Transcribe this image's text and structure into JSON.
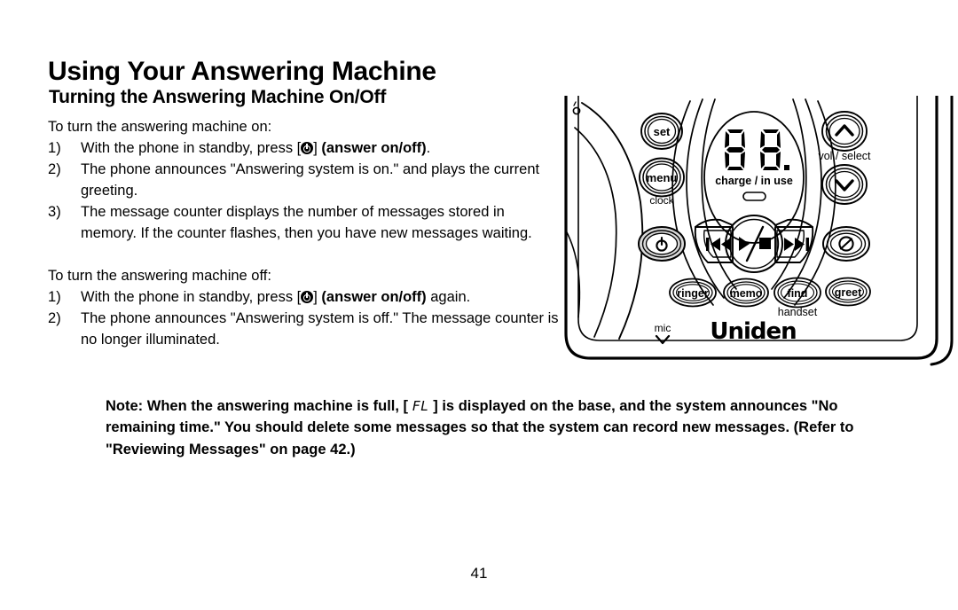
{
  "page": {
    "title": "Using Your Answering Machine",
    "subtitle": "Turning the Answering Machine On/Off",
    "number": "41"
  },
  "section_on": {
    "lead": "To turn the answering machine on:",
    "steps": [
      {
        "pre": "With the phone in standby, press [",
        "icon": "power-icon",
        "mid": "] ",
        "bold": "(answer on/off)",
        "post": "."
      },
      {
        "text": "The phone announces \"Answering system is on.\" and plays the current greeting."
      },
      {
        "text": "The message counter displays the number of messages stored in memory. If the counter flashes, then you have new messages waiting."
      }
    ]
  },
  "section_off": {
    "lead": "To turn the answering machine off:",
    "steps": [
      {
        "pre": "With the phone in standby, press [",
        "icon": "power-icon",
        "mid": "] ",
        "bold": "(answer on/off)",
        "post": " again."
      },
      {
        "text": "The phone announces \"Answering system is off.\" The message counter is no longer illuminated."
      }
    ]
  },
  "note": {
    "part1": "Note: When the answering machine is full, [ ",
    "lcd": "FL",
    "part2": " ] is displayed on the base, and the system announces \"No remaining time.\" You should delete some messages so that the system can record new messages. (Refer to \"Reviewing Messages\" on page 42.)"
  },
  "device": {
    "brand": "Uniden",
    "display": {
      "digits": "88.",
      "label": "charge / in use"
    },
    "buttons": {
      "set": "set",
      "menu": "menu",
      "menu_sub": "clock",
      "vol_label": "vol / select",
      "up": "chevron-up-icon",
      "down": "chevron-down-icon",
      "power": "power-icon",
      "rewind": "skip-back-icon",
      "playstop": "play-stop-icon",
      "forward": "skip-forward-icon",
      "mute": "mute-icon",
      "ringer": "ringer",
      "memo": "memo",
      "find": "find",
      "greet": "greet",
      "handset_label": "handset",
      "mic_label": "mic"
    }
  },
  "colors": {
    "ink": "#000000",
    "paper": "#ffffff",
    "button_fill": "#d9d9d9"
  }
}
